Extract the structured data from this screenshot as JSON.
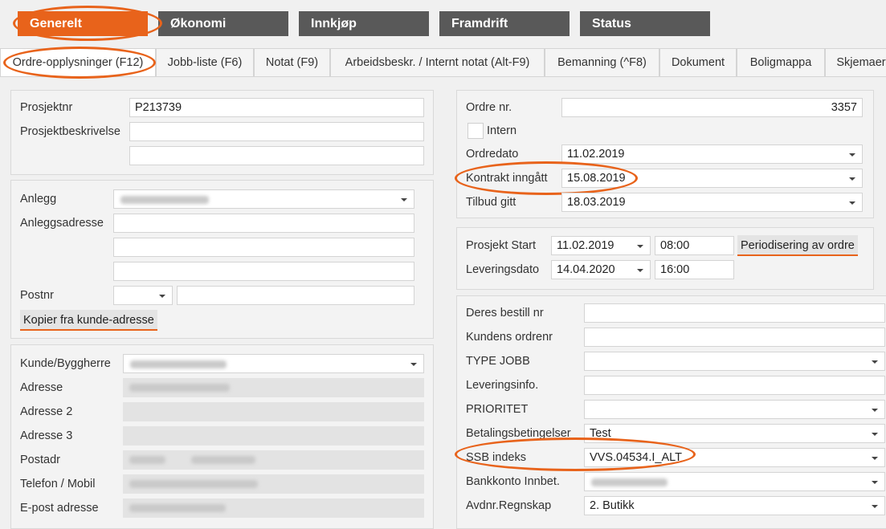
{
  "module_tabs": [
    "Generelt",
    "Økonomi",
    "Innkjøp",
    "Framdrift",
    "Status"
  ],
  "sub_tabs": [
    "Ordre-opplysninger (F12)",
    "Jobb-liste (F6)",
    "Notat (F9)",
    "Arbeidsbeskr. / Internt notat (Alt-F9)",
    "Bemanning (^F8)",
    "Dokument",
    "Boligmappa",
    "Skjemaer"
  ],
  "project": {
    "prosjektnr_label": "Prosjektnr",
    "prosjektnr_value": "P213739",
    "beskrivelse_label": "Prosjektbeskrivelse"
  },
  "site": {
    "anlegg_label": "Anlegg",
    "adresse_label": "Anleggsadresse",
    "postnr_label": "Postnr",
    "copy_button": "Kopier fra kunde-adresse"
  },
  "customer": {
    "kunde_label": "Kunde/Byggherre",
    "adresse_label": "Adresse",
    "adresse2_label": "Adresse 2",
    "adresse3_label": "Adresse 3",
    "postadr_label": "Postadr",
    "telefon_label": "Telefon / Mobil",
    "epost_label": "E-post adresse"
  },
  "order": {
    "ordrenr_label": "Ordre nr.",
    "ordrenr_value": "3357",
    "intern_label": "Intern",
    "ordredato_label": "Ordredato",
    "ordredato_value": "11.02.2019",
    "kontrakt_label": "Kontrakt inngått",
    "kontrakt_value": "15.08.2019",
    "tilbud_label": "Tilbud gitt",
    "tilbud_value": "18.03.2019"
  },
  "schedule": {
    "start_label": "Prosjekt Start",
    "start_date": "11.02.2019",
    "start_time": "08:00",
    "periodisering_button": "Periodisering av ordre",
    "levering_label": "Leveringsdato",
    "levering_date": "14.04.2020",
    "levering_time": "16:00"
  },
  "details": {
    "bestill_label": "Deres bestill nr",
    "kundens_label": "Kundens ordrenr",
    "type_label": "TYPE JOBB",
    "leveringsinfo_label": "Leveringsinfo.",
    "prioritet_label": "PRIORITET",
    "betaling_label": "Betalingsbetingelser",
    "betaling_value": "Test",
    "ssb_label": "SSB indeks",
    "ssb_value": "VVS.04534.I_ALT",
    "bankkonto_label": "Bankkonto Innbet.",
    "avdnr_label": "Avdnr.Regnskap",
    "avdnr_value": "2.  Butikk"
  },
  "colors": {
    "accent": "#e8631b",
    "module_tab": "#595959"
  }
}
